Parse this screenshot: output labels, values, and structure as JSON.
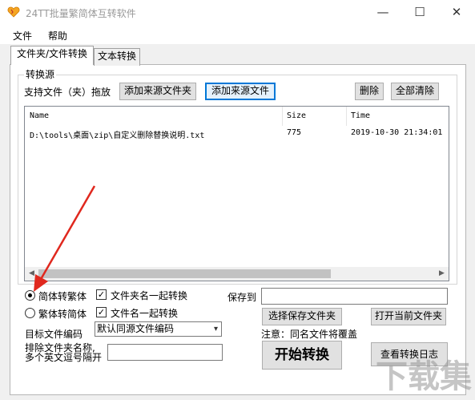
{
  "window": {
    "title": "24TT批量繁简体互转软件",
    "minimize": "—",
    "maximize": "☐",
    "close": "✕"
  },
  "menu": [
    "文件",
    "帮助"
  ],
  "tabs": [
    "文件夹/文件转换",
    "文本转换"
  ],
  "source_group": {
    "title": "转换源",
    "support_label": "支持文件（夹）拖放",
    "add_folder_button": "添加来源文件夹",
    "add_file_button": "添加来源文件",
    "delete_button": "删除",
    "clear_all_button": "全部清除"
  },
  "file_list": {
    "columns": [
      "Name",
      "Size",
      "Time"
    ],
    "rows": [
      {
        "name": "D:\\tools\\桌面\\zip\\自定义删除替换说明.txt",
        "size": "775",
        "time": "2019-10-30 21:34:01"
      }
    ],
    "scroll_left": "◀",
    "scroll_right": "▶"
  },
  "options": {
    "radio_s2t": "简体转繁体",
    "radio_t2s": "繁体转简体",
    "check_folder_name": "文件夹名一起转换",
    "check_file_name": "文件名一起转换",
    "check_mark": "✓",
    "encoding_label": "目标文件编码",
    "encoding_value": "默认同源文件编码",
    "exclude_label_1": "排除文件夹名称,",
    "exclude_label_2": "多个英文逗号隔开",
    "save_to_label": "保存到",
    "select_folder_button": "选择保存文件夹",
    "open_folder_button": "打开当前文件夹",
    "note": "注意：同名文件将覆盖",
    "start_button": "开始转换",
    "log_button": "查看转换日志"
  },
  "watermark": "下载集",
  "colors": {
    "accent": "#0078d7",
    "arrow": "#e0281e"
  }
}
